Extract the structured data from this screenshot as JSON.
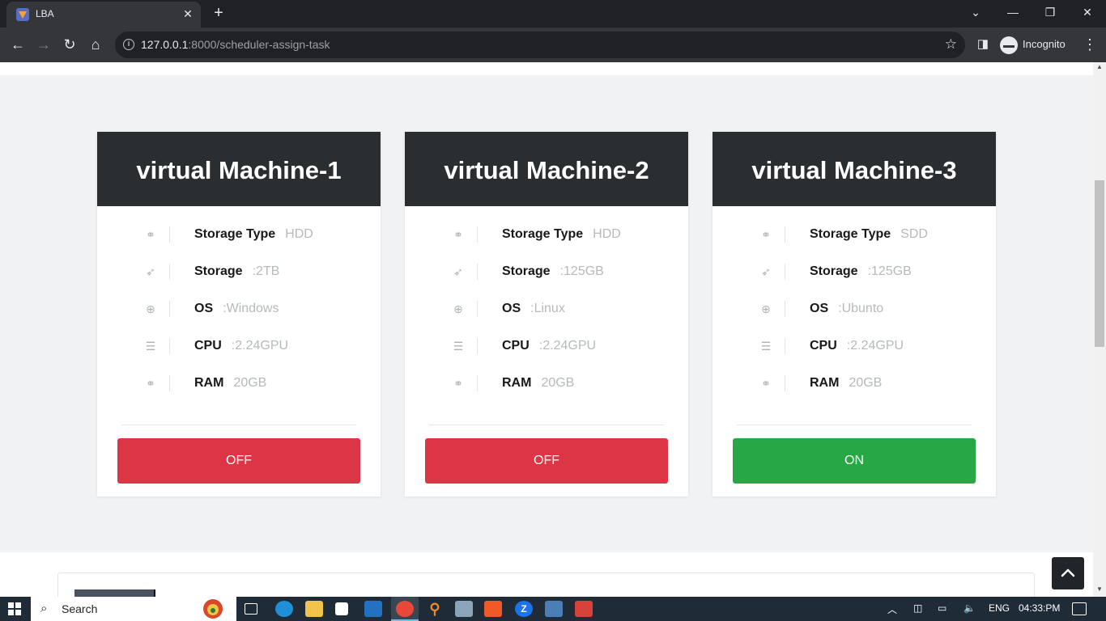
{
  "browser": {
    "tab_title": "LBA",
    "tab_close": "✕",
    "new_tab": "+",
    "url_host": "127.0.0.1",
    "url_path": ":8000/scheduler-assign-task",
    "incognito_label": "Incognito"
  },
  "machines": [
    {
      "title": "virtual Machine-1",
      "specs": [
        {
          "icon": "link-icon",
          "label": "Storage Type",
          "value": "HDD"
        },
        {
          "icon": "rocket-icon",
          "label": "Storage",
          "value": ":2TB"
        },
        {
          "icon": "lifebuoy-icon",
          "label": "OS",
          "value": ":Windows"
        },
        {
          "icon": "database-icon",
          "label": "CPU",
          "value": ":2.24GPU"
        },
        {
          "icon": "link-icon",
          "label": "RAM",
          "value": "20GB"
        }
      ],
      "status": "OFF",
      "status_color": "#dc3545"
    },
    {
      "title": "virtual Machine-2",
      "specs": [
        {
          "icon": "link-icon",
          "label": "Storage Type",
          "value": "HDD"
        },
        {
          "icon": "rocket-icon",
          "label": "Storage",
          "value": ":125GB"
        },
        {
          "icon": "lifebuoy-icon",
          "label": "OS",
          "value": ":Linux"
        },
        {
          "icon": "database-icon",
          "label": "CPU",
          "value": ":2.24GPU"
        },
        {
          "icon": "link-icon",
          "label": "RAM",
          "value": "20GB"
        }
      ],
      "status": "OFF",
      "status_color": "#dc3545"
    },
    {
      "title": "virtual Machine-3",
      "specs": [
        {
          "icon": "link-icon",
          "label": "Storage Type",
          "value": "SDD"
        },
        {
          "icon": "rocket-icon",
          "label": "Storage",
          "value": ":125GB"
        },
        {
          "icon": "lifebuoy-icon",
          "label": "OS",
          "value": ":Ubunto"
        },
        {
          "icon": "database-icon",
          "label": "CPU",
          "value": ":2.24GPU"
        },
        {
          "icon": "link-icon",
          "label": "RAM",
          "value": "20GB"
        }
      ],
      "status": "ON",
      "status_color": "#28a745"
    }
  ],
  "taskbar": {
    "search_label": "Search",
    "language": "ENG",
    "time": "04:33:PM"
  }
}
